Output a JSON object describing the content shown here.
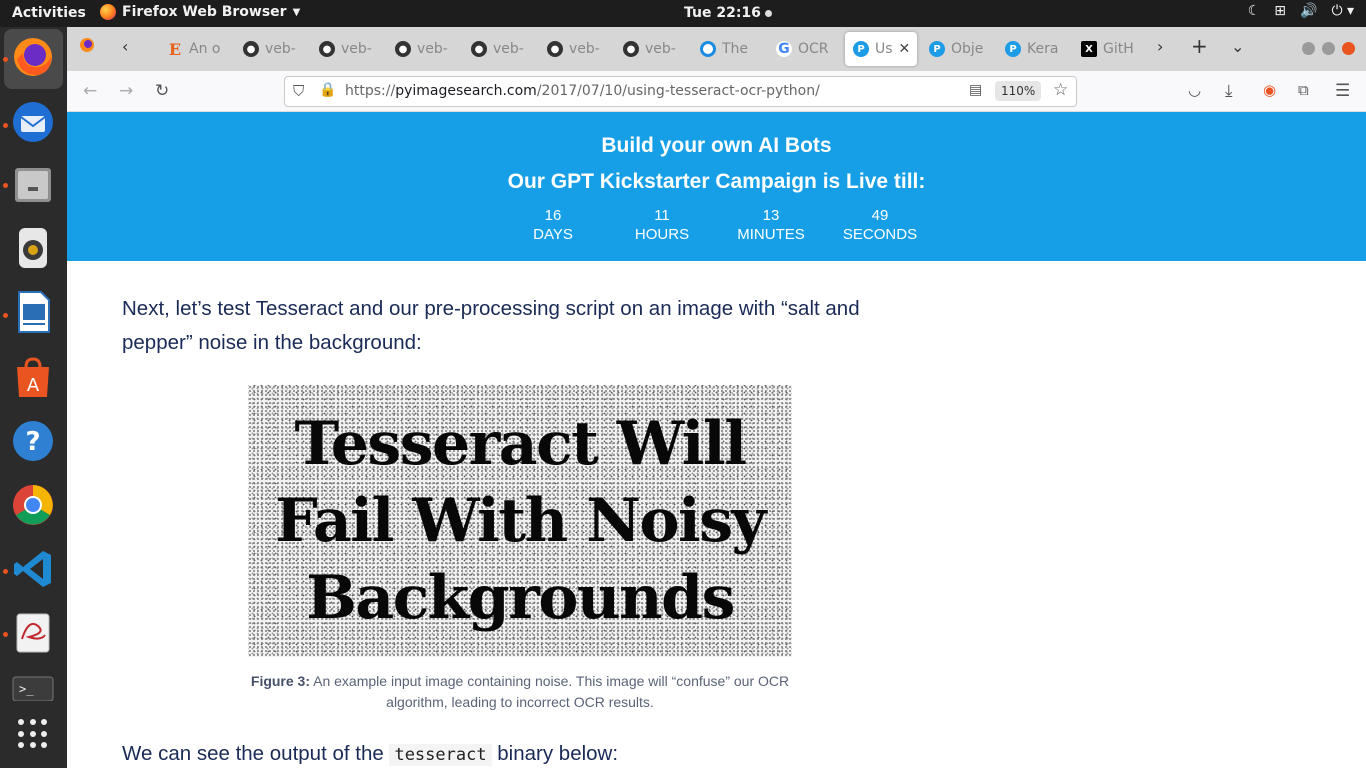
{
  "system": {
    "activities": "Activities",
    "app_name": "Firefox Web Browser",
    "clock": "Tue 22:16"
  },
  "tabs": [
    {
      "icon": "e-icon",
      "label": "An o"
    },
    {
      "icon": "github-icon",
      "label": "veb-"
    },
    {
      "icon": "github-icon",
      "label": "veb-"
    },
    {
      "icon": "github-icon",
      "label": "veb-"
    },
    {
      "icon": "github-icon",
      "label": "veb-"
    },
    {
      "icon": "github-icon",
      "label": "veb-"
    },
    {
      "icon": "github-icon",
      "label": "veb-"
    },
    {
      "icon": "circle-icon",
      "label": "The"
    },
    {
      "icon": "google-icon",
      "label": "OCR"
    },
    {
      "icon": "pyimagesearch-icon",
      "label": "Us",
      "active": true
    },
    {
      "icon": "pyimagesearch-icon",
      "label": "Obje"
    },
    {
      "icon": "pyimagesearch-icon",
      "label": "Kera"
    },
    {
      "icon": "x-icon",
      "label": "GitH"
    }
  ],
  "address_bar": {
    "url_prefix": "https://",
    "url_domain": "pyimagesearch.com",
    "url_path": "/2017/07/10/using-tesseract-ocr-python/",
    "zoom": "110%"
  },
  "banner": {
    "title": "Build your own AI Bots",
    "subtitle": "Our GPT Kickstarter Campaign is Live till:",
    "countdown": [
      {
        "value": "16",
        "unit": "DAYS"
      },
      {
        "value": "11",
        "unit": "HOURS"
      },
      {
        "value": "13",
        "unit": "MINUTES"
      },
      {
        "value": "49",
        "unit": "SECONDS"
      }
    ]
  },
  "article": {
    "para1": "Next, let’s test Tesseract and our pre-processing script on an image with “salt and pepper” noise in the background:",
    "figure_lines": [
      "Tesseract Will",
      "Fail With Noisy",
      "Backgrounds"
    ],
    "caption_label": "Figure 3:",
    "caption_text": " An example input image containing noise. This image will “confuse” our OCR algorithm, leading to incorrect OCR results.",
    "para2_before": "We can see the output of the ",
    "para2_code": "tesseract",
    "para2_after": " binary below:"
  },
  "colors": {
    "banner_bg": "#169fe6",
    "body_text": "#1b2b57",
    "ubuntu_orange": "#e95420"
  }
}
